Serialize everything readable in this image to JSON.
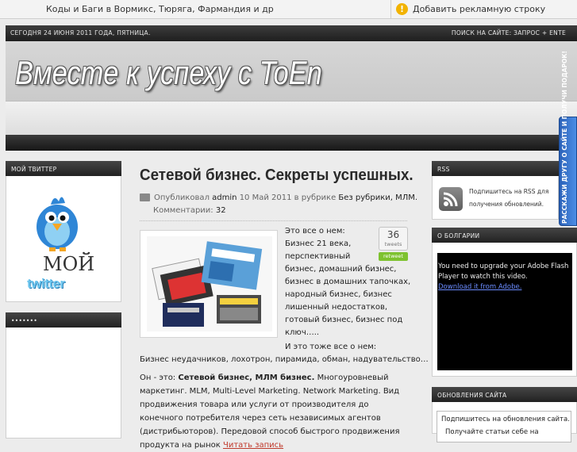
{
  "adbar": {
    "left_text": "Коды и Баги в Вормикс, Тюряга, Фармандия и др",
    "warning_glyph": "!",
    "right_text": "Добавить рекламную строку"
  },
  "header": {
    "date_text": "СЕГОДНЯ 24 ИЮНЯ 2011 ГОДА, ПЯТНИЦА.",
    "search_text": "ПОИСК НА САЙТЕ: ЗАПРОС + ENTE",
    "site_title": "Вместе к успеху с ToEn",
    "promo_tab": "РАССКАЖИ ДРУГУ О САЙТЕ И ПОЛУЧИ ПОДАРОК!"
  },
  "left_sidebar": {
    "twitter_widget_title": "МОЙ ТВИТТЕР",
    "twitter_moi": "МОЙ",
    "twitter_word": "twitter",
    "second_widget_title": "•••••••"
  },
  "post": {
    "title": "Сетевой бизнес. Секреты успешных.",
    "published_by_label": "Опубликовал",
    "author": "admin",
    "date": "10 Май 2011",
    "category_label": "в рубрике",
    "categories": "Без рубрики, МЛМ.",
    "comments_label": "Комментарии:",
    "comments_count": "32",
    "retweet_count": "36",
    "retweet_unit": "tweets",
    "retweet_button": "retweet",
    "lead_lines": [
      "Это все о нем:",
      "Бизнес 21 века,",
      "перспективный",
      "бизнес, домашний бизнес,",
      "бизнес в домашних тапочках,",
      "народный бизнес, бизнес",
      "лишенный недостатков,",
      "готовый бизнес, бизнес под",
      "ключ….."
    ],
    "para2": "И это тоже все о нем:",
    "para3": "Бизнес неудачников, лохотрон, пирамида, обман, надувательство…",
    "body_prefix": "Он - это:",
    "body_bold": "Сетевой бизнес, МЛМ бизнес.",
    "body_text": "Многоуровневый маркетинг. MLM, Multi-Level Marketing. Network Marketing. Вид продвижения товара или услуги от производителя до конечного потребителя через сеть независимых агентов (дистрибьюторов). Передовой способ быстрого продвижения продукта на рынок",
    "read_more": "Читать запись"
  },
  "right_sidebar": {
    "rss_title": "RSS",
    "rss_text": "Подпишитесь на RSS для получения обновлений.",
    "bulgaria_title": "О БОЛГАРИИ",
    "flash_message": "You need to upgrade your Adobe Flash Player to watch this video.",
    "flash_link": "Download it from Adobe.",
    "updates_title": "ОБНОВЛЕНИЯ САЙТА",
    "subscribe_line1": "Подпишитесь на обновления сайта.",
    "subscribe_line2": "Получайте статьи себе на"
  }
}
